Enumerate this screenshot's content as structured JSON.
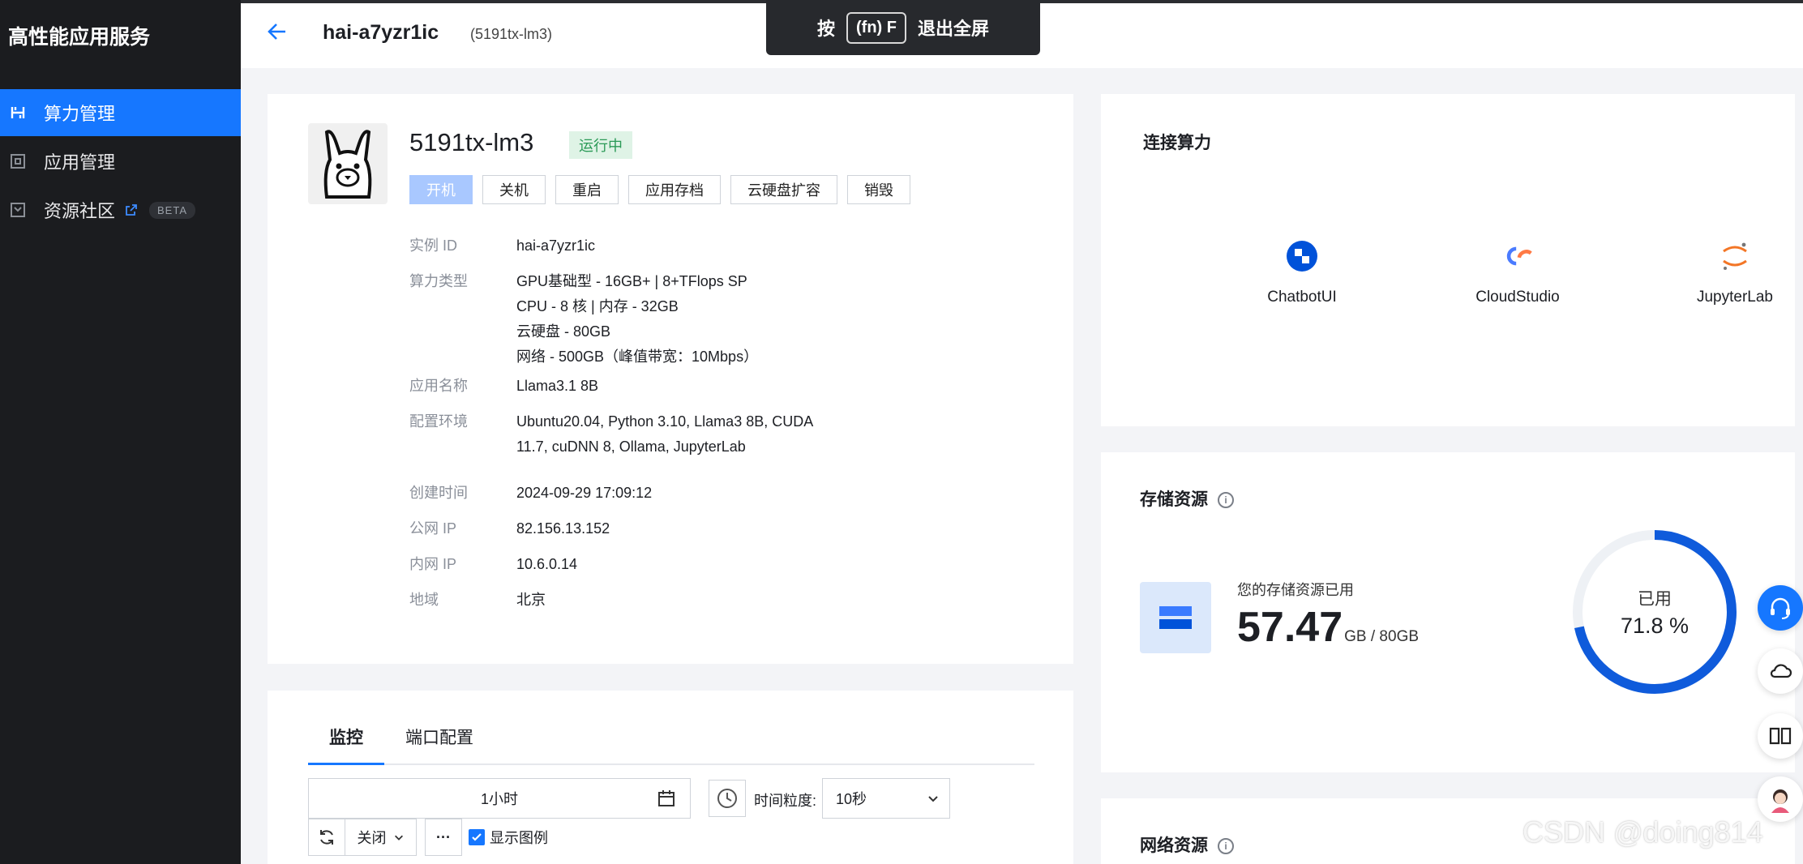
{
  "sidebar": {
    "brand": "高性能应用服务",
    "items": [
      {
        "label": "算力管理",
        "icon": "compute-icon",
        "active": true
      },
      {
        "label": "应用管理",
        "icon": "app-icon",
        "active": false
      },
      {
        "label": "资源社区",
        "icon": "community-icon",
        "active": false,
        "badge": "BETA"
      }
    ]
  },
  "header": {
    "title": "hai-a7yzr1ic",
    "subtitle": "(5191tx-lm3)"
  },
  "fullscreen_toast": {
    "prefix": "按",
    "key": "(fn) F",
    "suffix": "退出全屏"
  },
  "instance": {
    "name": "5191tx-lm3",
    "status": "运行中",
    "actions": [
      "开机",
      "关机",
      "重启",
      "应用存档",
      "云硬盘扩容",
      "销毁"
    ],
    "details": {
      "id_label": "实例 ID",
      "id": "hai-a7yzr1ic",
      "type_label": "算力类型",
      "type_lines": [
        "GPU基础型 - 16GB+ | 8+TFlops SP",
        "CPU - 8 核 | 内存 - 32GB",
        "云硬盘 - 80GB",
        "网络 - 500GB（峰值带宽：10Mbps）"
      ],
      "app_label": "应用名称",
      "app": "Llama3.1 8B",
      "env_label": "配置环境",
      "env_lines": [
        "Ubuntu20.04, Python 3.10, Llama3 8B, CUDA",
        "11.7, cuDNN 8, Ollama, JupyterLab"
      ],
      "created_label": "创建时间",
      "created": "2024-09-29 17:09:12",
      "public_ip_label": "公网 IP",
      "public_ip": "82.156.13.152",
      "private_ip_label": "内网 IP",
      "private_ip": "10.6.0.14",
      "region_label": "地域",
      "region": "北京"
    }
  },
  "connect": {
    "title": "连接算力",
    "apps": [
      {
        "label": "ChatbotUI",
        "icon": "chatbotui-icon"
      },
      {
        "label": "CloudStudio",
        "icon": "cloudstudio-icon"
      },
      {
        "label": "JupyterLab",
        "icon": "jupyter-icon"
      }
    ]
  },
  "storage": {
    "title": "存储资源",
    "used_label": "您的存储资源已用",
    "used_value": "57.47",
    "total": "GB / 80GB",
    "ring_label": "已用",
    "ring_value": "71.8 %",
    "percent": 71.8
  },
  "network": {
    "title": "网络资源"
  },
  "monitor": {
    "tabs": [
      "监控",
      "端口配置"
    ],
    "time_range": "1小时",
    "granularity_label": "时间粒度:",
    "granularity": "10秒",
    "refresh_option": "关闭",
    "more": "···",
    "legend_toggle": "显示图例"
  },
  "watermark": "CSDN @doing814",
  "colors": {
    "accent": "#1677ff",
    "sidebar_bg": "#1b1c1f",
    "status_green": "#2b9a57"
  }
}
